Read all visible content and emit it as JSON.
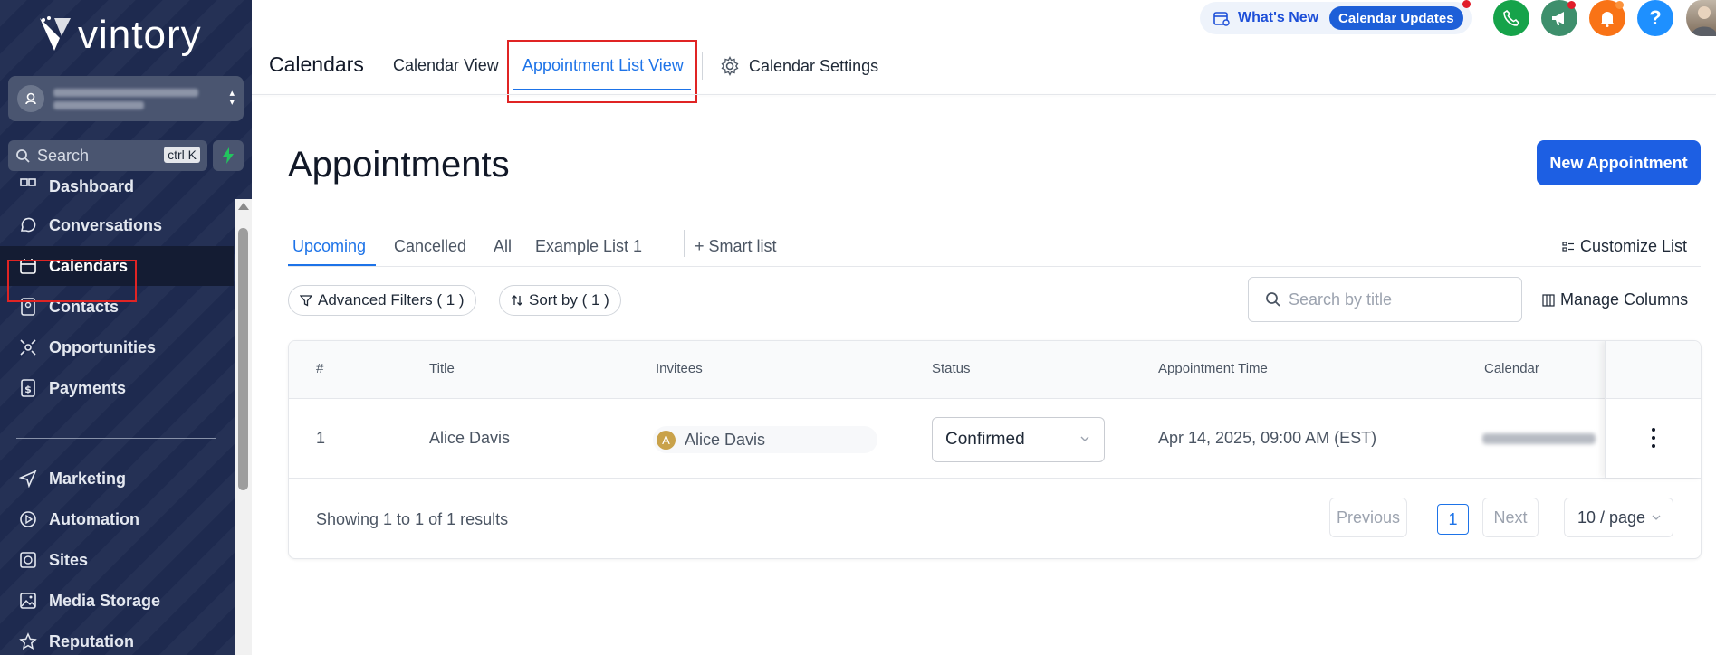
{
  "brand": {
    "name": "vintory"
  },
  "sidebar": {
    "search_placeholder": "Search",
    "search_shortcut": "ctrl K",
    "items": [
      {
        "label": "Dashboard",
        "icon": "dashboard-icon"
      },
      {
        "label": "Conversations",
        "icon": "chat-icon"
      },
      {
        "label": "Calendars",
        "icon": "calendar-icon",
        "active": true
      },
      {
        "label": "Contacts",
        "icon": "contacts-icon"
      },
      {
        "label": "Opportunities",
        "icon": "opportunities-icon"
      },
      {
        "label": "Payments",
        "icon": "payments-icon"
      },
      {
        "label": "Marketing",
        "icon": "send-icon"
      },
      {
        "label": "Automation",
        "icon": "play-circle-icon"
      },
      {
        "label": "Sites",
        "icon": "globe-icon"
      },
      {
        "label": "Media Storage",
        "icon": "image-icon"
      },
      {
        "label": "Reputation",
        "icon": "star-icon"
      }
    ]
  },
  "header": {
    "title": "Calendars",
    "tabs": [
      {
        "label": "Calendar View"
      },
      {
        "label": "Appointment List View",
        "active": true
      },
      {
        "label": "Calendar Settings"
      }
    ],
    "whats_new": "What's New",
    "calendar_updates": "Calendar Updates",
    "help_glyph": "?"
  },
  "main": {
    "heading": "Appointments",
    "new_button": "New Appointment",
    "subtabs": [
      {
        "label": "Upcoming",
        "active": true
      },
      {
        "label": "Cancelled"
      },
      {
        "label": "All"
      },
      {
        "label": "Example List 1"
      }
    ],
    "smart_list": "+ Smart list",
    "customize_list": "Customize List",
    "advanced_filters": "Advanced Filters ( 1 )",
    "sort_by": "Sort by ( 1 )",
    "search_placeholder": "Search by title",
    "manage_columns": "Manage Columns"
  },
  "table": {
    "columns": [
      "#",
      "Title",
      "Invitees",
      "Status",
      "Appointment Time",
      "Calendar"
    ],
    "rows": [
      {
        "index": "1",
        "title": "Alice Davis",
        "invitee_initial": "A",
        "invitee": "Alice Davis",
        "status": "Confirmed",
        "time": "Apr 14, 2025, 09:00 AM (EST)"
      }
    ],
    "footer": "Showing 1 to 1 of 1 results",
    "prev": "Previous",
    "page": "1",
    "next": "Next",
    "per_page": "10 / page"
  },
  "colors": {
    "sidebar_bg": "#1e2a4f",
    "accent": "#1d73e8",
    "primary_button": "#1d5fe3",
    "highlight_box": "#e02424",
    "phone_green": "#16a34a",
    "megaphone_teal": "#3e8f6c",
    "bell_orange": "#f97316",
    "help_blue": "#1e90ff"
  }
}
